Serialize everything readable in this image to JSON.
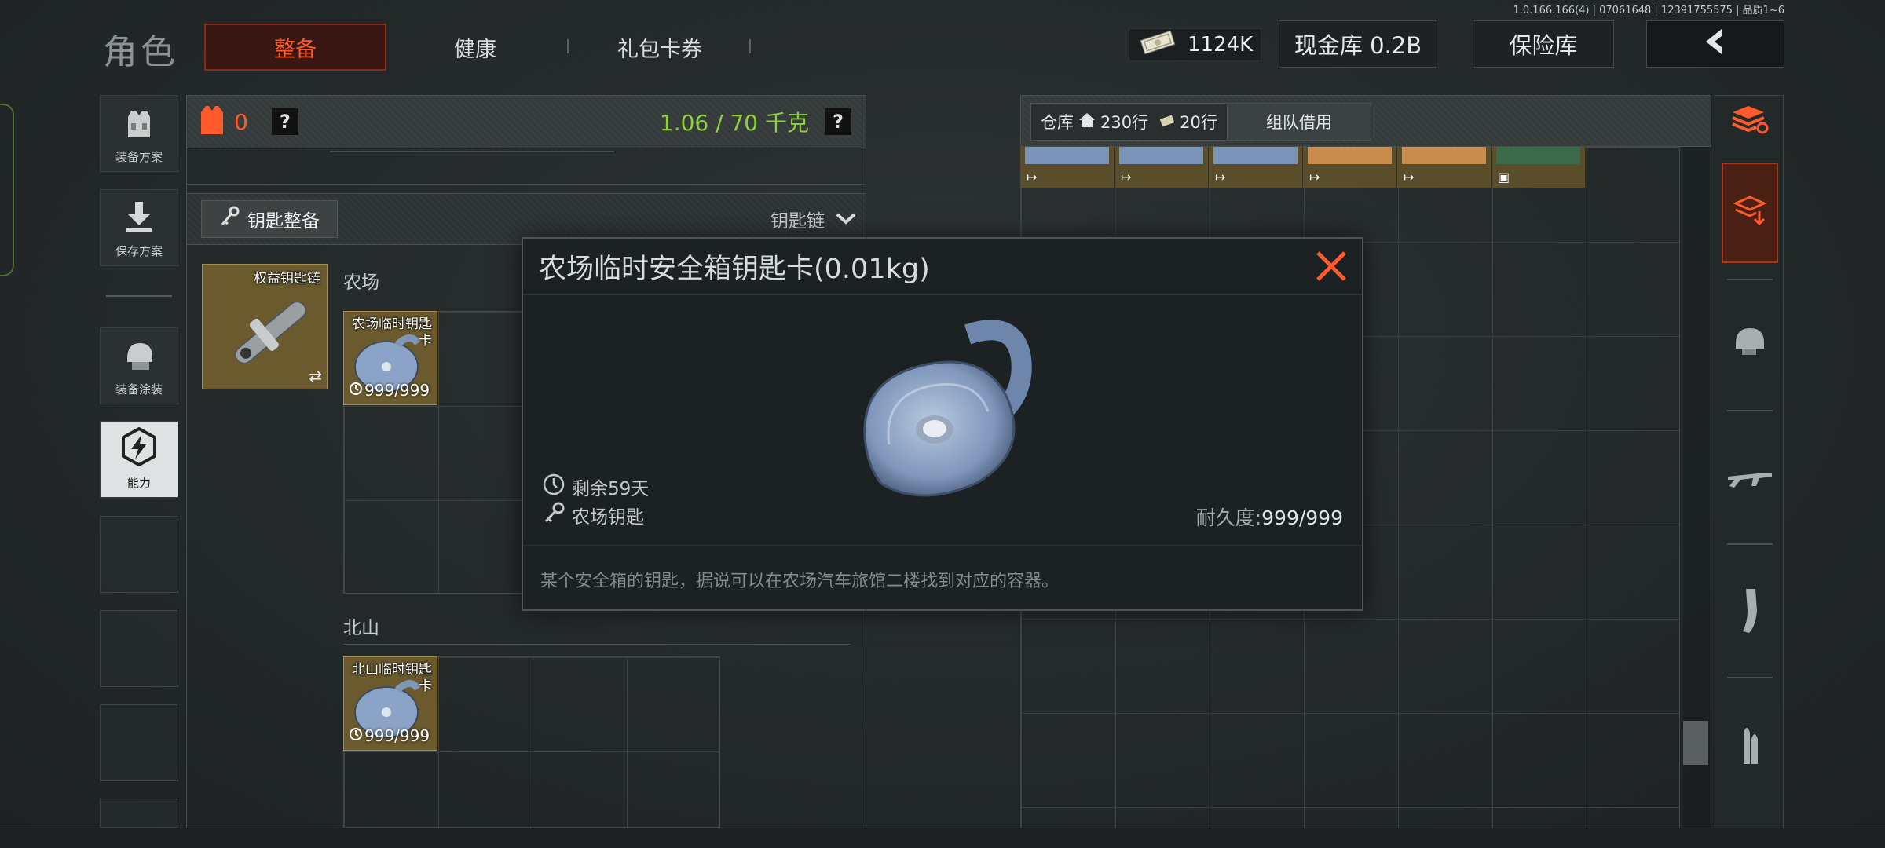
{
  "version": "1.0.166.166(4) | 07061648 | 12391755575 | 品质1~6",
  "header": {
    "title": "角色",
    "tabs": [
      {
        "label": "整备",
        "active": true
      },
      {
        "label": "健康",
        "active": false
      },
      {
        "label": "礼包卡券",
        "active": false
      }
    ],
    "money": "1124K",
    "cash_vault": "现金库 0.2B",
    "insurance": "保险库"
  },
  "sidebar": {
    "items": [
      {
        "label": "装备方案"
      },
      {
        "label": "保存方案"
      },
      {
        "label": "装备涂装"
      },
      {
        "label": "能力"
      }
    ]
  },
  "weight_bar": {
    "armor_count": "0",
    "weight": "1.06 / 70 千克",
    "help": "?"
  },
  "keychain": {
    "button_label": "钥匙整备",
    "dropdown_label": "钥匙链",
    "main_slot_label": "权益钥匙链",
    "sections": [
      {
        "title": "农场",
        "items": [
          {
            "label": "农场临时钥匙卡",
            "count": "999/999"
          }
        ]
      },
      {
        "title": "北山",
        "items": [
          {
            "label": "北山临时钥匙卡",
            "count": "999/999"
          }
        ]
      }
    ]
  },
  "warehouse": {
    "tag_label": "仓库",
    "rows": "230行",
    "slots": "20行",
    "team_borrow": "组队借用"
  },
  "modal": {
    "title": "农场临时安全箱钥匙卡(0.01kg)",
    "remaining": "剩余59天",
    "key_type": "农场钥匙",
    "durability_label": "耐久度:",
    "durability_value": "999/999",
    "description": "某个安全箱的钥匙，据说可以在农场汽车旅馆二楼找到对应的容器。"
  },
  "colors": {
    "accent": "#ff5a2c",
    "weight_ok": "#8ed23a",
    "slot_gold": "#6b5a2e"
  }
}
